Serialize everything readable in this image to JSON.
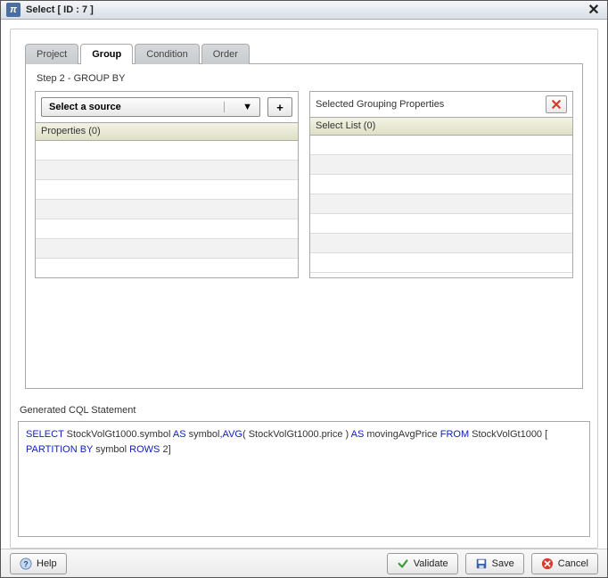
{
  "titlebar": {
    "title": "Select [ ID : 7 ]"
  },
  "tabs": {
    "project": "Project",
    "group": "Group",
    "condition": "Condition",
    "order": "Order"
  },
  "step_label": "Step 2 - GROUP BY",
  "left": {
    "source_placeholder": "Select a source",
    "add_label": "+",
    "grid_header": "Properties (0)"
  },
  "right": {
    "title": "Selected Grouping Properties",
    "grid_header": "Select List (0)"
  },
  "cql": {
    "label": "Generated CQL Statement",
    "tokens": [
      {
        "t": "kw",
        "v": "SELECT"
      },
      {
        "t": "txt",
        "v": " StockVolGt1000.symbol "
      },
      {
        "t": "kw",
        "v": "AS"
      },
      {
        "t": "txt",
        "v": " symbol,"
      },
      {
        "t": "kw",
        "v": "AVG"
      },
      {
        "t": "txt",
        "v": "( StockVolGt1000.price ) "
      },
      {
        "t": "kw",
        "v": "AS"
      },
      {
        "t": "txt",
        "v": " movingAvgPrice "
      },
      {
        "t": "kw",
        "v": "FROM"
      },
      {
        "t": "txt",
        "v": " StockVolGt1000  ["
      },
      {
        "t": "br"
      },
      {
        "t": "kw",
        "v": "PARTITION BY"
      },
      {
        "t": "txt",
        "v": " symbol  "
      },
      {
        "t": "kw",
        "v": "ROWS"
      },
      {
        "t": "txt",
        "v": " 2]"
      }
    ]
  },
  "footer": {
    "help": "Help",
    "validate": "Validate",
    "save": "Save",
    "cancel": "Cancel"
  }
}
